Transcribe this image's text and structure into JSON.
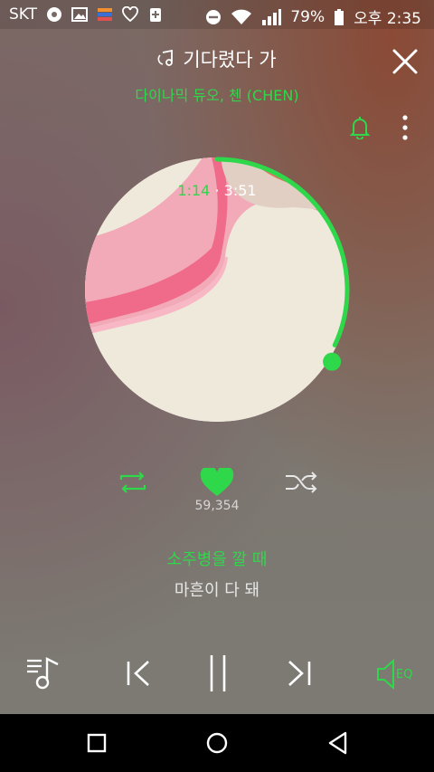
{
  "status_bar": {
    "carrier": "SKT",
    "battery": "79%",
    "time": "오후 2:35"
  },
  "track": {
    "title": "기다렸다 가",
    "artist": "다이나믹 듀오, 첸 (CHEN)"
  },
  "player": {
    "current_time": "1:14",
    "separator": "·",
    "total_time": "3:51",
    "progress": 0.32
  },
  "likes": {
    "count": "59,354"
  },
  "lyrics": {
    "current": "소주병을 깔 때",
    "next": "마흔이 다 돼"
  },
  "controls": {
    "eq_label": "EQ"
  },
  "colors": {
    "accent": "#2ed84a"
  }
}
